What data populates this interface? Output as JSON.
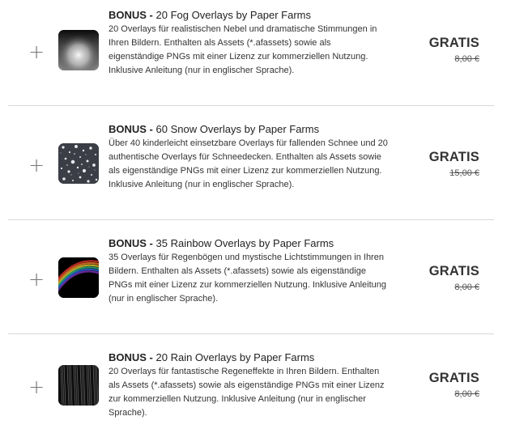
{
  "products": [
    {
      "bonus": "BONUS -",
      "name": "20 Fog Overlays by Paper Farms",
      "description": "20 Overlays für realistischen Nebel und dramatische Stimmungen in Ihren Bildern. Enthalten als Assets (*.afassets) sowie als eigenständige PNGs mit einer Lizenz zur kommerziellen Nutzung. Inklusive Anleitung (nur in englischer Sprache).",
      "price": "GRATIS",
      "old_price": "8,00 €",
      "add_icon": "plus-icon"
    },
    {
      "bonus": "BONUS -",
      "name": "60 Snow Overlays by Paper Farms",
      "description": "Über 40 kinderleicht einsetzbare Overlays für fallenden Schnee und 20 authentische Overlays für Schneedecken. Enthalten als Assets sowie als eigenständige PNGs mit einer Lizenz zur kommerziellen Nutzung. Inklusive Anleitung (nur in englischer Sprache).",
      "price": "GRATIS",
      "old_price": "15,00 €",
      "add_icon": "plus-icon"
    },
    {
      "bonus": "BONUS -",
      "name": "35 Rainbow Overlays by Paper Farms",
      "description": "35 Overlays für Regenbögen und mystische Lichtstimmungen in Ihren Bildern. Enthalten als Assets (*.afassets) sowie als eigenständige PNGs mit einer Lizenz zur kommerziellen Nutzung. Inklusive Anleitung (nur in englischer Sprache).",
      "price": "GRATIS",
      "old_price": "8,00 €",
      "add_icon": "plus-icon"
    },
    {
      "bonus": "BONUS -",
      "name": "20 Rain Overlays by Paper Farms",
      "description": "20 Overlays für fantastische Regeneffekte in Ihren Bildern. Enthalten als Assets (*.afassets) sowie als eigenständige PNGs mit einer Lizenz zur kommerziellen Nutzung. Inklusive Anleitung (nur in englischer Sprache).",
      "price": "GRATIS",
      "old_price": "8,00 €",
      "add_icon": "plus-icon"
    }
  ],
  "colors": {
    "divider": "#d9d9d9",
    "text": "#2a2a2a",
    "plus": "#777777"
  }
}
